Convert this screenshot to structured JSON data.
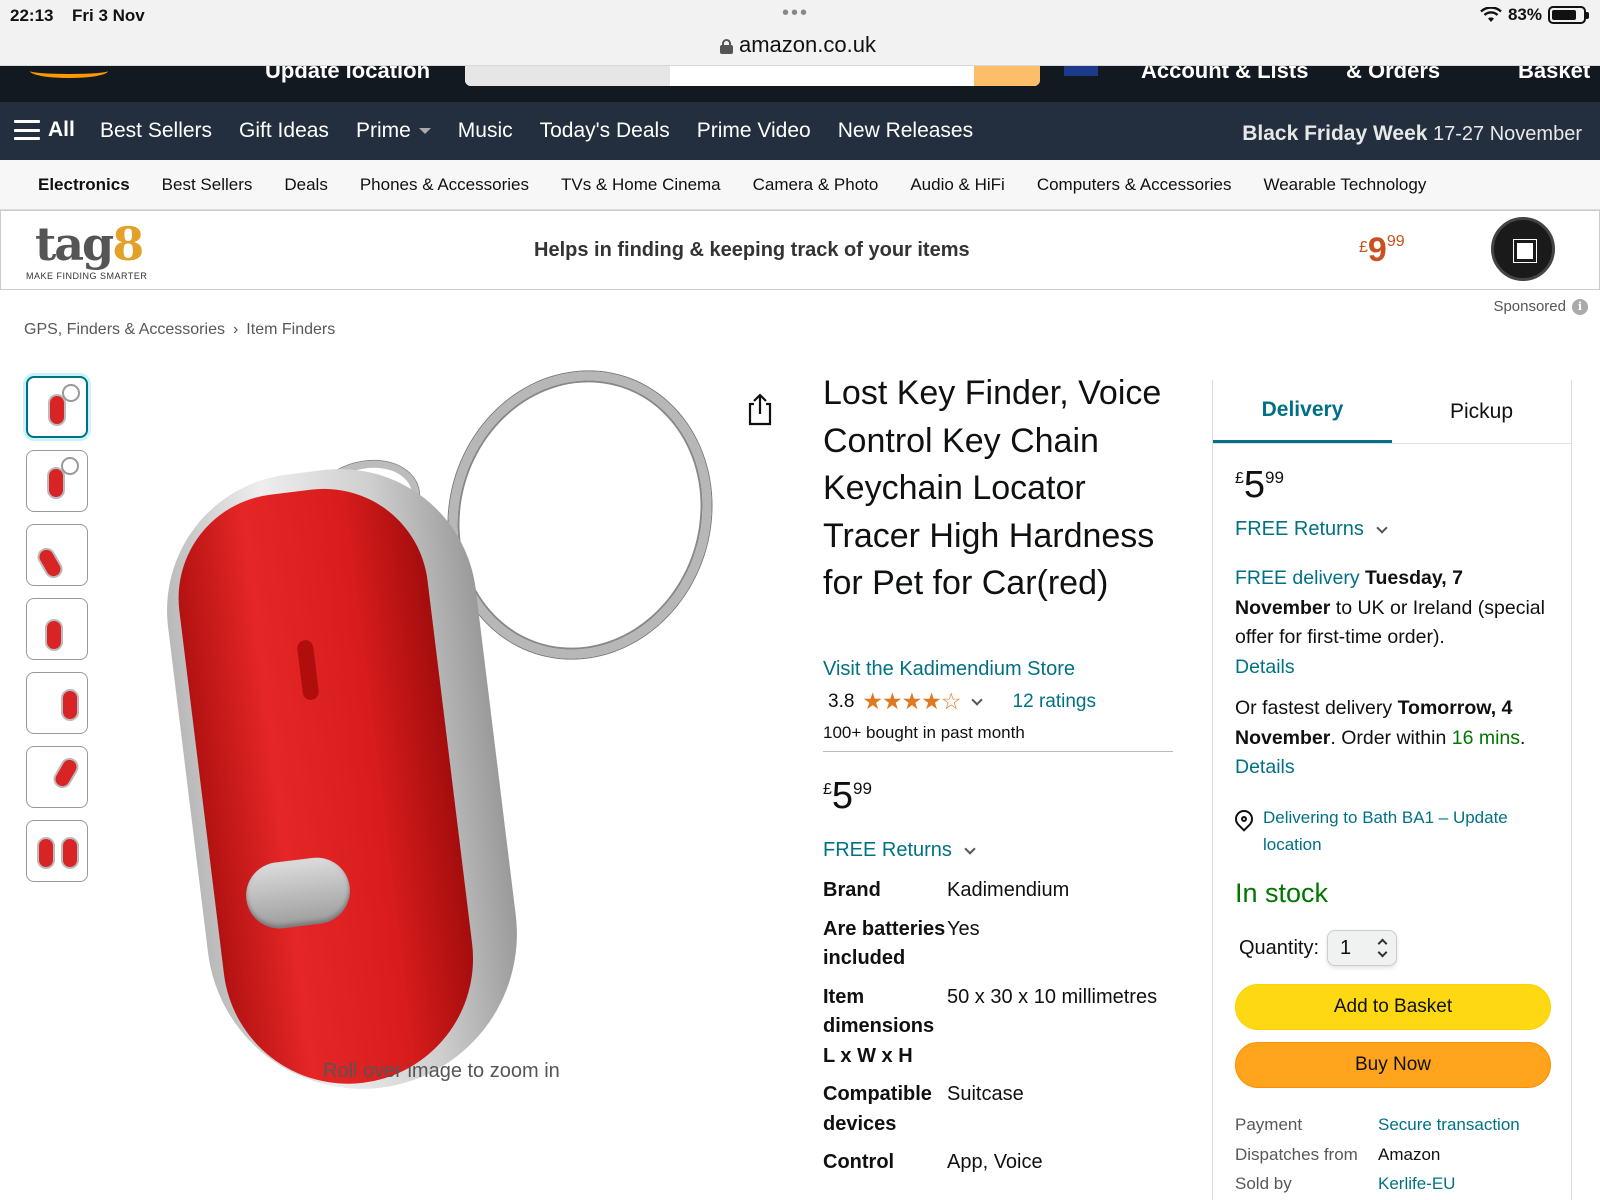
{
  "status_bar": {
    "time": "22:13",
    "date": "Fri 3 Nov",
    "battery": "83%",
    "url": "amazon.co.uk"
  },
  "nav_top_partial": {
    "update_location": "Update location",
    "account": "Account & Lists",
    "orders": "& Orders",
    "basket": "Basket"
  },
  "nav_main": {
    "all_label": "All",
    "links": [
      "Best Sellers",
      "Gift Ideas",
      "Prime",
      "Music",
      "Today's Deals",
      "Prime Video",
      "New Releases"
    ],
    "promo_bold": "Black Friday Week",
    "promo_dates": "17-27",
    "promo_month": "November"
  },
  "subnav": [
    "Electronics",
    "Best Sellers",
    "Deals",
    "Phones & Accessories",
    "TVs & Home Cinema",
    "Camera & Photo",
    "Audio & HiFi",
    "Computers & Accessories",
    "Wearable Technology"
  ],
  "banner": {
    "logo": "tag",
    "logo_mark": "8",
    "tagline": "MAKE FINDING SMARTER",
    "headline": "Helps in finding & keeping track of your items",
    "price_symbol": "£",
    "price_whole": "9",
    "price_fraction": "99"
  },
  "sponsored_label": "Sponsored",
  "breadcrumb": {
    "parent": "GPS, Finders & Accessories",
    "separator": "›",
    "current": "Item Finders"
  },
  "gallery": {
    "thumb_count": 7,
    "zoom_caption": "Roll over image to zoom in"
  },
  "product": {
    "title": "Lost Key Finder, Voice Control Key Chain Keychain Locator Tracer High Hardness for Pet for Car(red)",
    "store_link": "Visit the Kadimendium Store",
    "rating": "3.8",
    "stars": "★★★★☆",
    "ratings_count": "12 ratings",
    "bought": "100+ bought in past month",
    "price_symbol": "£",
    "price_whole": "5",
    "price_fraction": "99",
    "returns": "FREE Returns",
    "specs": [
      {
        "key": "Brand",
        "value": "Kadimendium"
      },
      {
        "key": "Are batteries included",
        "value": "Yes"
      },
      {
        "key": "Item dimensions L x W x H",
        "value": "50 x 30 x 10 millimetres"
      },
      {
        "key": "Compatible devices",
        "value": "Suitcase"
      },
      {
        "key": "Control",
        "value": "App, Voice"
      }
    ]
  },
  "buybox": {
    "tab_delivery": "Delivery",
    "tab_pickup": "Pickup",
    "price_symbol": "£",
    "price_whole": "5",
    "price_fraction": "99",
    "returns": "FREE Returns",
    "free_delivery_link": "FREE delivery",
    "delivery_date": "Tuesday, 7 November",
    "delivery_rest": "to UK or Ireland (special offer for first-time order).",
    "details_1": "Details",
    "fastest_prefix": "Or fastest delivery",
    "fastest_date": "Tomorrow, 4 November",
    "order_within": ". Order within",
    "countdown": "16 mins",
    "period": ".",
    "details_2": "Details",
    "location": "Delivering to Bath BA1 – Update location",
    "stock": "In stock",
    "quantity_label": "Quantity:",
    "quantity_value": "1",
    "add_to_basket": "Add to Basket",
    "buy_now": "Buy Now",
    "info": [
      {
        "key": "Payment",
        "value": "Secure transaction",
        "link": true
      },
      {
        "key": "Dispatches from",
        "value": "Amazon",
        "link": false
      },
      {
        "key": "Sold by",
        "value": "Kerlife-EU",
        "link": true
      }
    ]
  },
  "colors": {
    "amazon_dark": "#131921",
    "nav": "#232f3e",
    "link": "#007185",
    "in_stock": "#007600",
    "basket_button": "#ffd814",
    "buy_button": "#ffa41c",
    "star": "#de7921",
    "banner_price": "#c7511f"
  }
}
